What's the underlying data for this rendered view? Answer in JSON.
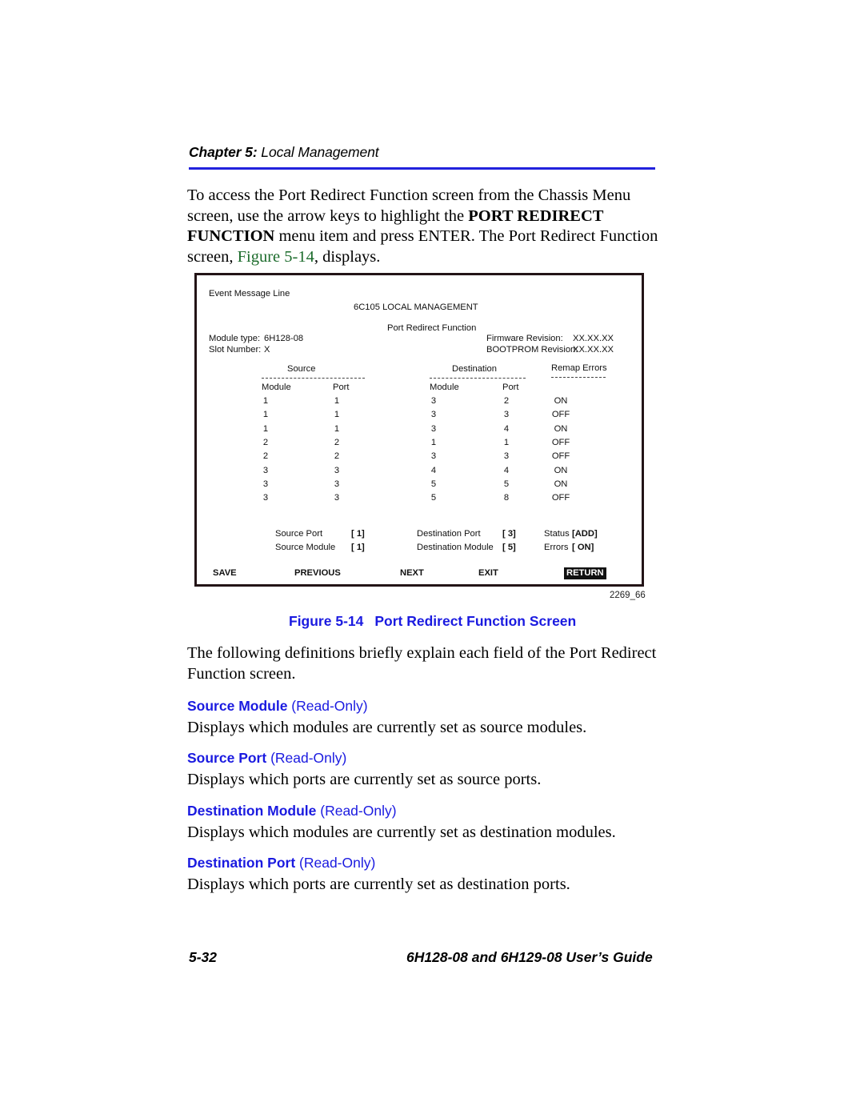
{
  "header": {
    "chapter_label": "Chapter 5:",
    "chapter_title": " Local Management",
    "rule_color": "#2222dd"
  },
  "intro": {
    "line1": "To access the Port Redirect Function screen from the Chassis Menu",
    "line2_a": "screen, use the arrow keys to highlight the ",
    "line2_b": "PORT REDIRECT",
    "line3_a": "FUNCTION",
    "line3_b": " menu item and press ENTER. The Port Redirect Function",
    "line4_a": "screen, ",
    "line4_ref": "Figure 5-14",
    "line4_b": ", displays."
  },
  "figure": {
    "id_label": "2269_66",
    "caption_number": "Figure 5-14",
    "caption_title": "Port Redirect Function Screen",
    "screen": {
      "event_message_line": "Event Message Line",
      "system_title": "6C105 LOCAL MANAGEMENT",
      "screen_title": "Port Redirect Function",
      "module_type_label": "Module type:",
      "module_type_value": "6H128-08",
      "slot_number_label": "Slot Number:",
      "slot_number_value": "X",
      "firmware_label": "Firmware Revision:",
      "firmware_value": "XX.XX.XX",
      "bootprom_label": "BOOTPROM Revision:",
      "bootprom_value": "XX.XX.XX",
      "group_headers": {
        "source": "Source",
        "destination": "Destination",
        "remap_errors": "Remap Errors"
      },
      "column_headers": {
        "source_module": "Module",
        "source_port": "Port",
        "destination_module": "Module",
        "destination_port": "Port"
      },
      "rows": [
        {
          "src_module": "1",
          "src_port": "1",
          "dst_module": "3",
          "dst_port": "2",
          "remap": "ON"
        },
        {
          "src_module": "1",
          "src_port": "1",
          "dst_module": "3",
          "dst_port": "3",
          "remap": "OFF"
        },
        {
          "src_module": "1",
          "src_port": "1",
          "dst_module": "3",
          "dst_port": "4",
          "remap": "ON"
        },
        {
          "src_module": "2",
          "src_port": "2",
          "dst_module": "1",
          "dst_port": "1",
          "remap": "OFF"
        },
        {
          "src_module": "2",
          "src_port": "2",
          "dst_module": "3",
          "dst_port": "3",
          "remap": "OFF"
        },
        {
          "src_module": "3",
          "src_port": "3",
          "dst_module": "4",
          "dst_port": "4",
          "remap": "ON"
        },
        {
          "src_module": "3",
          "src_port": "3",
          "dst_module": "5",
          "dst_port": "5",
          "remap": "ON"
        },
        {
          "src_module": "3",
          "src_port": "3",
          "dst_module": "5",
          "dst_port": "8",
          "remap": "OFF"
        }
      ],
      "fields": {
        "source_port_label": "Source Port",
        "source_port_value": "[  1]",
        "source_module_label": "Source Module",
        "source_module_value": "[  1]",
        "destination_port_label": "Destination Port",
        "destination_port_value": "[  3]",
        "destination_module_label": "Destination Module",
        "destination_module_value": "[  5]",
        "status_label": "Status",
        "status_value": "[ADD]",
        "errors_label": "Errors",
        "errors_value": "[ ON]"
      },
      "buttons": [
        {
          "label": "SAVE",
          "selected": false
        },
        {
          "label": "PREVIOUS",
          "selected": false
        },
        {
          "label": "NEXT",
          "selected": false
        },
        {
          "label": "EXIT",
          "selected": false
        },
        {
          "label": "RETURN",
          "selected": true
        }
      ]
    }
  },
  "definitions_intro": {
    "line1": "The following definitions briefly explain each field of the Port Redirect",
    "line2": "Function screen."
  },
  "definitions": [
    {
      "term": "Source Module",
      "note": " (Read-Only)",
      "body": "Displays which modules are currently set as source modules."
    },
    {
      "term": "Source Port",
      "note": " (Read-Only)",
      "body": "Displays which ports are currently set as source ports."
    },
    {
      "term": "Destination Module",
      "note": " (Read-Only)",
      "body": "Displays which modules are currently set as destination modules."
    },
    {
      "term": "Destination Port",
      "note": " (Read-Only)",
      "body": "Displays which ports are currently set as destination ports."
    }
  ],
  "footer": {
    "page_number": "5-32",
    "guide_title": "6H128-08 and 6H129-08 User’s Guide"
  }
}
